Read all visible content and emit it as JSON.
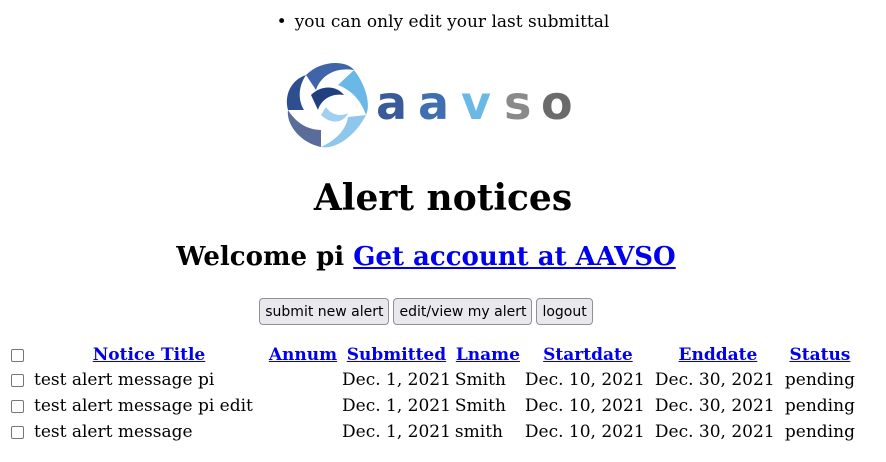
{
  "notice": {
    "bullet": "•",
    "text": "you can only edit your last submittal"
  },
  "logo": {
    "text": "aavso"
  },
  "page_title": "Alert notices",
  "welcome": {
    "text": "Welcome pi",
    "link": "Get account at AAVSO"
  },
  "buttons": {
    "submit": "submit new alert",
    "edit": "edit/view my alert",
    "logout": "logout"
  },
  "table": {
    "headers": [
      "Notice Title",
      "Annum",
      "Submitted",
      "Lname",
      "Startdate",
      "Enddate",
      "Status"
    ],
    "rows": [
      [
        "test alert message pi",
        "",
        "Dec. 1, 2021",
        "Smith",
        "Dec. 10, 2021",
        "Dec. 30, 2021",
        "pending"
      ],
      [
        "test alert message pi edit",
        "",
        "Dec. 1, 2021",
        "Smith",
        "Dec. 10, 2021",
        "Dec. 30, 2021",
        "pending"
      ],
      [
        "test alert message",
        "",
        "Dec. 1, 2021",
        "smith",
        "Dec. 10, 2021",
        "Dec. 30, 2021",
        "pending"
      ]
    ]
  },
  "colors": {
    "link": "#0000ee",
    "logo_blue_dark": "#3a5a9a",
    "logo_blue_light": "#6ab0e0",
    "logo_gray": "#6b6b6b"
  }
}
